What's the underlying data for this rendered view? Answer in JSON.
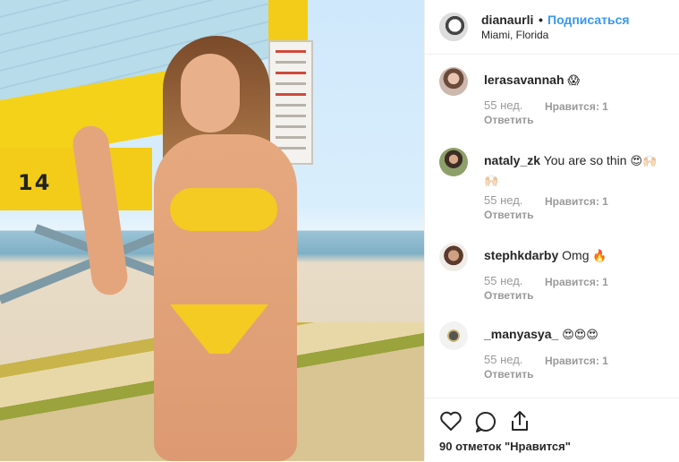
{
  "post": {
    "username": "dianaurli",
    "dot": "•",
    "follow_label": "Подписаться",
    "location": "Miami, Florida",
    "photo_number": "14"
  },
  "comments": [
    {
      "user": "lerasavannah",
      "text": "",
      "emoji": "😱",
      "time": "55 нед.",
      "likes": "Нравится: 1",
      "reply": "Ответить"
    },
    {
      "user": "nataly_zk",
      "text": "You are so thin",
      "emoji": "😍🙌🏻🙌🏻",
      "time": "55 нед.",
      "likes": "Нравится: 1",
      "reply": "Ответить"
    },
    {
      "user": "stephkdarby",
      "text": "Omg",
      "emoji": "🔥",
      "time": "55 нед.",
      "likes": "Нравится: 1",
      "reply": "Ответить"
    },
    {
      "user": "_manyasya_",
      "text": "",
      "emoji": "😍😍😍",
      "time": "55 нед.",
      "likes": "Нравится: 1",
      "reply": "Ответить"
    }
  ],
  "actions": {
    "like_icon": "heart-outline",
    "comment_icon": "speech-bubble",
    "share_icon": "share-upload",
    "likes_count": "90 отметок \"Нравится\""
  },
  "colors": {
    "accent": "#3897f0",
    "muted": "#999999",
    "divider": "#efefef"
  }
}
